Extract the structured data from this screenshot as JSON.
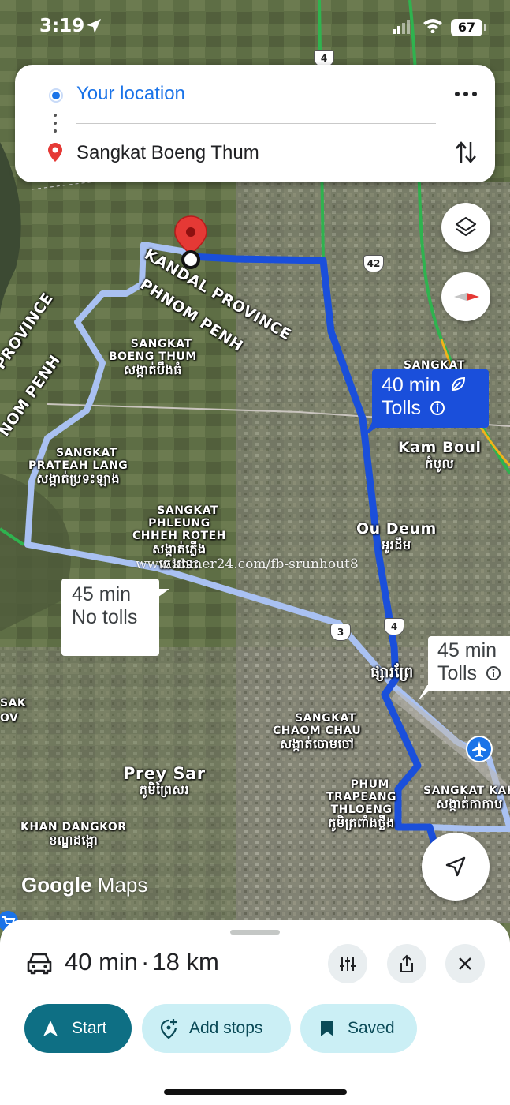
{
  "status_bar": {
    "time": "3:19",
    "battery": "67"
  },
  "directions": {
    "origin": "Your location",
    "destination": "Sangkat Boeng Thum"
  },
  "map": {
    "labels": {
      "kandal": "KANDAL PROVINCE",
      "phnom_penh_1": "PHNOM PENH",
      "province_left": "PROVINCE",
      "phnom_penh_2": "NOM PENH",
      "boeng_thum": "SANGKAT\nBOENG THUM",
      "boeng_thum_km": "សង្កាត់បឹងធំ",
      "prateah_lang": "SANGKAT\nPRATEAH LANG",
      "prateah_lang_km": "សង្កាត់ប្រទះឡាង",
      "phleung": "SANGKAT\nPHLEUNG\nCHHEH ROTEH",
      "phleung_km": "សង្កាត់ភ្លើង\nឆេះរទេះ",
      "sangkat_top": "SANGKAT",
      "kam_boul": "Kam Boul",
      "kam_boul_km": "កំបូល",
      "ou_deum": "Ou Deum",
      "ou_deum_km": "អូរដឹម",
      "phsar_km": "ផ្សារព្រែ",
      "chaom_chau": "SANGKAT\nCHAOM CHAU",
      "chaom_chau_km": "សង្កាត់ចោមចៅ",
      "prey_sar": "Prey Sar",
      "prey_sar_km": "ភូមិព្រៃសរ",
      "trapeang": "PHUM\nTRAPEANG\nTHLOENG",
      "trapeang_km": "ភូមិត្រពាំងថ្លឹង",
      "kakab": "SANGKAT KAK",
      "kakab_km": "សង្កាត់កាកាប",
      "dangkor": "KHAN DANGKOR",
      "dangkor_km": "ខណ្ឌដង្កោ",
      "sak": "SAK",
      "ov": "OV"
    },
    "road_shields": [
      "4",
      "42",
      "3",
      "4"
    ],
    "watermark": "www.khmer24.com/fb-srunhout8",
    "logo": {
      "google": "Google",
      "maps": "Maps"
    }
  },
  "routes": {
    "primary": {
      "time": "40 min",
      "tolls": "Tolls"
    },
    "alt_no_tolls": {
      "time": "45 min",
      "tolls": "No tolls"
    },
    "alt_tolls": {
      "time": "45 min",
      "tolls": "Tolls"
    }
  },
  "sheet": {
    "duration": "40 min",
    "separator": "·",
    "distance": "18 km",
    "start": "Start",
    "add_stops": "Add stops",
    "saved": "Saved"
  },
  "colors": {
    "route_primary": "#1a4fdb",
    "route_alt": "#a9c1f2",
    "start_button": "#0e6f84",
    "secondary_button": "#cbeff5",
    "accent_blue": "#1a73e8",
    "pin_red": "#e53935"
  }
}
